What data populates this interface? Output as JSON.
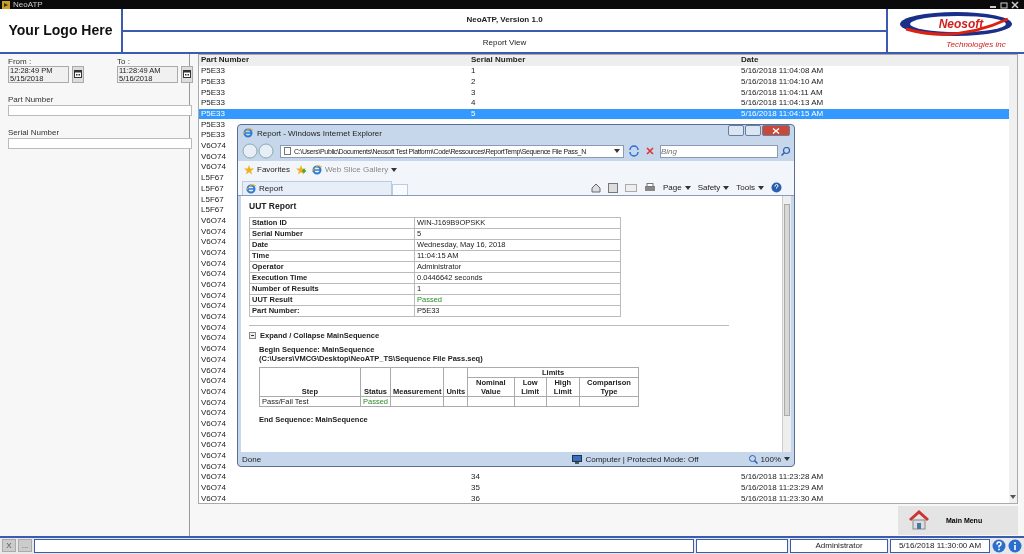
{
  "window": {
    "title": "NeoATP"
  },
  "header": {
    "logo_placeholder": "Your Logo Here",
    "app_title": "NeoATP, Version 1.0",
    "view_title": "Report View",
    "brand_logo": {
      "name": "Neosoft",
      "tagline": "Technologies inc"
    }
  },
  "filters": {
    "from": {
      "label": "From :",
      "time": "12:28:49 PM",
      "date": "5/15/2018"
    },
    "to": {
      "label": "To :",
      "time": "11:28:49 AM",
      "date": "5/16/2018"
    },
    "fields": [
      {
        "label": "Part Number"
      },
      {
        "label": "Serial Number"
      }
    ]
  },
  "table": {
    "columns": [
      "Part Number",
      "Serial Number",
      "Date"
    ],
    "rows": [
      {
        "part_number": "P5E33",
        "serial_number": "1",
        "date": "5/16/2018 11:04:08 AM",
        "selected": false
      },
      {
        "part_number": "P5E33",
        "serial_number": "2",
        "date": "5/16/2018 11:04:10 AM",
        "selected": false
      },
      {
        "part_number": "P5E33",
        "serial_number": "3",
        "date": "5/16/2018 11:04:11 AM",
        "selected": false
      },
      {
        "part_number": "P5E33",
        "serial_number": "4",
        "date": "5/16/2018 11:04:13 AM",
        "selected": false
      },
      {
        "part_number": "P5E33",
        "serial_number": "5",
        "date": "5/16/2018 11:04:15 AM",
        "selected": true
      },
      {
        "part_number": "P5E33",
        "selected": false
      },
      {
        "part_number": "P5E33",
        "selected": false
      },
      {
        "part_number": "V6O74",
        "selected": false
      },
      {
        "part_number": "V6O74",
        "selected": false
      },
      {
        "part_number": "V6O74",
        "selected": false
      },
      {
        "part_number": "L5F67",
        "selected": false
      },
      {
        "part_number": "L5F67",
        "selected": false
      },
      {
        "part_number": "L5F67",
        "selected": false
      },
      {
        "part_number": "L5F67",
        "selected": false
      },
      {
        "part_number": "V6O74",
        "selected": false
      },
      {
        "part_number": "V6O74",
        "selected": false
      },
      {
        "part_number": "V6O74",
        "selected": false
      },
      {
        "part_number": "V6O74",
        "selected": false
      },
      {
        "part_number": "V6O74",
        "selected": false
      },
      {
        "part_number": "V6O74",
        "selected": false
      },
      {
        "part_number": "V6O74",
        "selected": false
      },
      {
        "part_number": "V6O74",
        "selected": false
      },
      {
        "part_number": "V6O74",
        "selected": false
      },
      {
        "part_number": "V6O74",
        "selected": false
      },
      {
        "part_number": "V6O74",
        "selected": false
      },
      {
        "part_number": "V6O74",
        "selected": false
      },
      {
        "part_number": "V6O74",
        "selected": false
      },
      {
        "part_number": "V6O74",
        "selected": false
      },
      {
        "part_number": "V6O74",
        "selected": false
      },
      {
        "part_number": "V6O74",
        "selected": false
      },
      {
        "part_number": "V6O74",
        "selected": false
      },
      {
        "part_number": "V6O74",
        "selected": false
      },
      {
        "part_number": "V6O74",
        "selected": false
      },
      {
        "part_number": "V6O74",
        "selected": false
      },
      {
        "part_number": "V6O74",
        "selected": false
      },
      {
        "part_number": "V6O74",
        "selected": false
      },
      {
        "part_number": "V6O74",
        "selected": false
      },
      {
        "part_number": "V6O74",
        "selected": false
      },
      {
        "part_number": "V6O74",
        "serial_number": "34",
        "date": "5/16/2018 11:23:28 AM",
        "selected": false
      },
      {
        "part_number": "V6O74",
        "serial_number": "35",
        "date": "5/16/2018 11:23:29 AM",
        "selected": false
      },
      {
        "part_number": "V6O74",
        "serial_number": "36",
        "date": "5/16/2018 11:23:30 AM",
        "selected": false
      }
    ]
  },
  "main_menu_button": "Main Menu",
  "status_bar": {
    "buttons": [
      "X",
      "..."
    ],
    "user": "Administrator",
    "datetime": "5/16/2018 11:30:00 AM"
  },
  "browser": {
    "title": "Report - Windows Internet Explorer",
    "address": "C:\\Users\\Public\\Documents\\Neosoft Test Platform\\Code\\Ressources\\ReportTemp\\Sequence File Pass_N",
    "search_placeholder": "Bing",
    "favorites": "Favorites",
    "web_slice": "Web Slice Gallery",
    "tab": "Report",
    "commands": [
      "Page",
      "Safety",
      "Tools"
    ],
    "report": {
      "heading": "UUT Report",
      "info": [
        {
          "label": "Station ID",
          "value": "WIN-J169B9OPSKK",
          "kind": "text"
        },
        {
          "label": "Serial Number",
          "value": "5",
          "kind": "text"
        },
        {
          "label": "Date",
          "value": "Wednesday, May 16, 2018",
          "kind": "text"
        },
        {
          "label": "Time",
          "value": "11:04:15 AM",
          "kind": "text"
        },
        {
          "label": "Operator",
          "value": "Administrator",
          "kind": "text"
        },
        {
          "label": "Execution Time",
          "value": "0.0446642 seconds",
          "kind": "text"
        },
        {
          "label": "Number of Results",
          "value": "1",
          "kind": "text"
        },
        {
          "label": "UUT Result",
          "value": "Passed",
          "kind": "status"
        },
        {
          "label": "Part Number:",
          "value": "P5E33",
          "kind": "text"
        }
      ],
      "expand_label": "Expand / Collapse MainSequence",
      "begin": "Begin Sequence: MainSequence",
      "begin_path": "(C:\\Users\\VMCG\\Desktop\\NeoATP_TS\\Sequence File Pass.seq)",
      "steps": {
        "columns": [
          "Step",
          "Status",
          "Measurement",
          "Units",
          "Nominal Value",
          "Low Limit",
          "High Limit",
          "Comparison Type"
        ],
        "group_header": "Limits",
        "rows": [
          {
            "step": "Pass/Fail Test",
            "status": "Passed"
          }
        ]
      },
      "end": "End Sequence: MainSequence"
    },
    "status": {
      "text": "Done",
      "zone": "Computer | Protected Mode: Off",
      "zoom": "100%"
    }
  }
}
